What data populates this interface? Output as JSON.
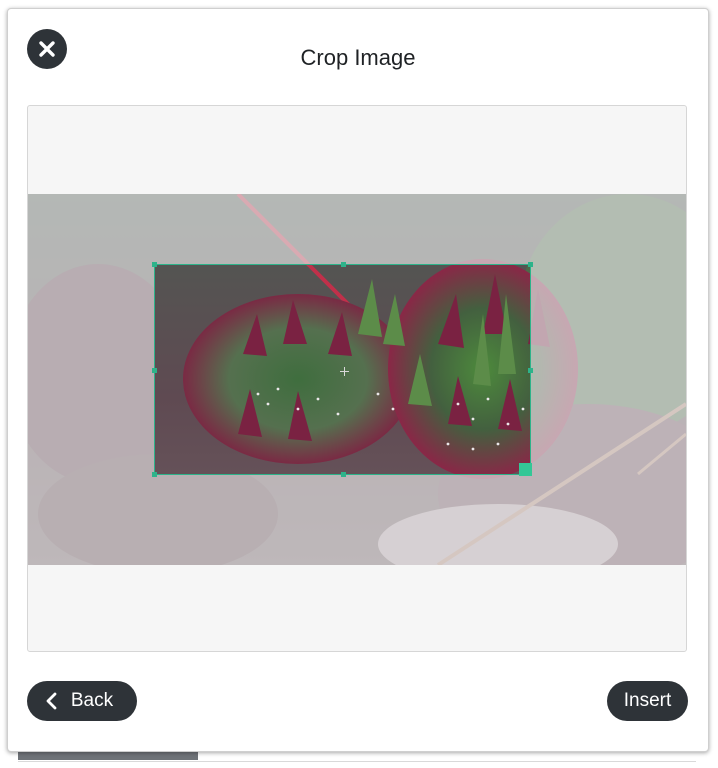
{
  "dialog": {
    "title": "Crop Image",
    "close_icon": "close-icon"
  },
  "cropper": {
    "image_subject": "succulent plants",
    "accent_color": "#2db38a"
  },
  "footer": {
    "back_label": "Back",
    "back_icon": "chevron-left-icon",
    "insert_label": "Insert"
  },
  "colors": {
    "button_bg": "#2e3338",
    "crop_border": "#2db38a"
  }
}
